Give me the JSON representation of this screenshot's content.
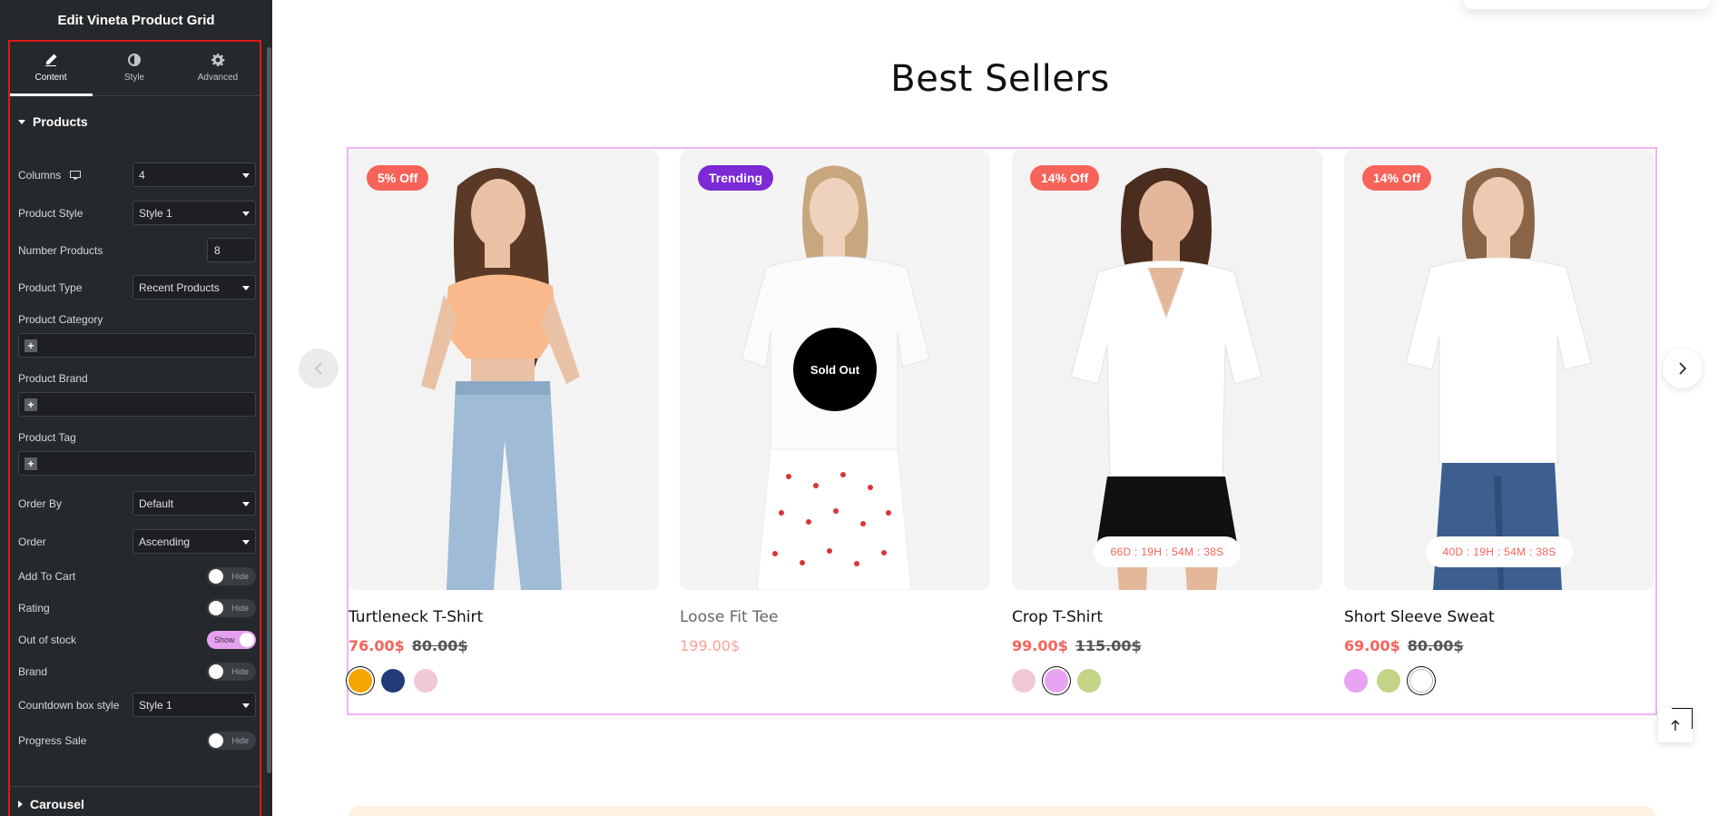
{
  "panel": {
    "title": "Edit Vineta Product Grid",
    "tabs": [
      {
        "label": "Content",
        "icon": "pencil-icon",
        "active": true
      },
      {
        "label": "Style",
        "icon": "half-circle-icon",
        "active": false
      },
      {
        "label": "Advanced",
        "icon": "gear-icon",
        "active": false
      }
    ],
    "section_products": "Products",
    "section_carousel": "Carousel",
    "controls": {
      "columns": {
        "label": "Columns",
        "value": "4",
        "icon": "desktop-icon"
      },
      "product_style": {
        "label": "Product Style",
        "value": "Style 1"
      },
      "number_products": {
        "label": "Number Products",
        "value": "8"
      },
      "product_type": {
        "label": "Product Type",
        "value": "Recent Products"
      },
      "product_category": {
        "label": "Product Category"
      },
      "product_brand": {
        "label": "Product Brand"
      },
      "product_tag": {
        "label": "Product Tag"
      },
      "order_by": {
        "label": "Order By",
        "value": "Default"
      },
      "order": {
        "label": "Order",
        "value": "Ascending"
      },
      "add_to_cart": {
        "label": "Add To Cart",
        "toggle": "Hide"
      },
      "rating": {
        "label": "Rating",
        "toggle": "Hide"
      },
      "out_of_stock": {
        "label": "Out of stock",
        "toggle": "Show"
      },
      "brand": {
        "label": "Brand",
        "toggle": "Hide"
      },
      "countdown_box_style": {
        "label": "Countdown box style",
        "value": "Style 1"
      },
      "progress_sale": {
        "label": "Progress Sale",
        "toggle": "Hide"
      }
    },
    "plus_symbol": "+"
  },
  "preview": {
    "heading": "Best Sellers",
    "products": [
      {
        "name": "Turtleneck T-Shirt",
        "badge": "5% Off",
        "price": "76.00$",
        "old_price": "80.00$",
        "swatches": [
          "#f5a500",
          "#233b78",
          "#f0c8d6"
        ]
      },
      {
        "name": "Loose Fit Tee",
        "badge": "Trending",
        "price": "199.00$",
        "sold_out": "Sold Out",
        "swatches": []
      },
      {
        "name": "Crop T-Shirt",
        "badge": "14% Off",
        "price": "99.00$",
        "old_price": "115.00$",
        "countdown": "66D : 19H : 54M : 38S",
        "swatches": [
          "#f0c8d6",
          "#e8a3f3",
          "#c4d487"
        ]
      },
      {
        "name": "Short Sleeve Sweat",
        "badge": "14% Off",
        "price": "69.00$",
        "old_price": "80.00$",
        "countdown": "40D : 19H : 54M : 38S",
        "swatches": [
          "#e8a3f3",
          "#c4d487",
          "#ffffff"
        ]
      }
    ],
    "accent_color": "#f7635a",
    "trending_color": "#7b2ad6"
  }
}
